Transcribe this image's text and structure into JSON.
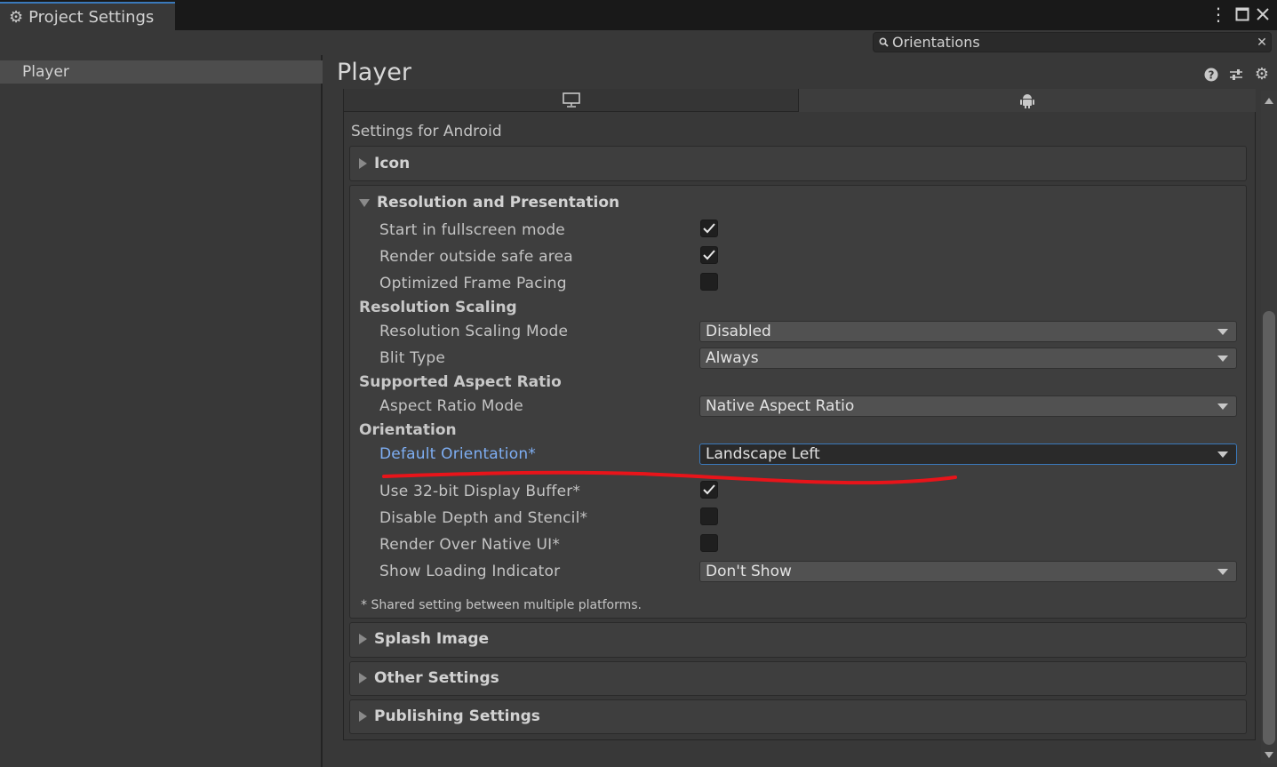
{
  "window": {
    "tab_title": "Project Settings",
    "search_value": "Orientations"
  },
  "sidebar": {
    "items": [
      {
        "label": "Player",
        "selected": true
      }
    ]
  },
  "header": {
    "title": "Player"
  },
  "platform_tabs": [
    {
      "icon": "monitor-icon",
      "selected": false
    },
    {
      "icon": "android-icon",
      "selected": true
    }
  ],
  "settings_for": "Settings for Android",
  "sections": {
    "icon": {
      "title": "Icon",
      "expanded": false
    },
    "resolution": {
      "title": "Resolution and Presentation",
      "expanded": true
    },
    "splash": {
      "title": "Splash Image",
      "expanded": false
    },
    "other": {
      "title": "Other Settings",
      "expanded": false
    },
    "publishing": {
      "title": "Publishing Settings",
      "expanded": false
    }
  },
  "resolution": {
    "start_fullscreen": {
      "label": "Start in fullscreen mode",
      "checked": true
    },
    "render_outside_safe": {
      "label": "Render outside safe area",
      "checked": true
    },
    "optimized_frame_pacing": {
      "label": "Optimized Frame Pacing",
      "checked": false
    },
    "group_resolution_scaling": "Resolution Scaling",
    "scaling_mode": {
      "label": "Resolution Scaling Mode",
      "value": "Disabled"
    },
    "blit_type": {
      "label": "Blit Type",
      "value": "Always"
    },
    "group_aspect": "Supported Aspect Ratio",
    "aspect_mode": {
      "label": "Aspect Ratio Mode",
      "value": "Native Aspect Ratio"
    },
    "group_orientation": "Orientation",
    "default_orientation": {
      "label": "Default Orientation*",
      "value": "Landscape Left"
    },
    "display_buffer": {
      "label": "Use 32-bit Display Buffer*",
      "checked": true
    },
    "disable_depth": {
      "label": "Disable Depth and Stencil*",
      "checked": false
    },
    "render_over_native": {
      "label": "Render Over Native UI*",
      "checked": false
    },
    "loading_indicator": {
      "label": "Show Loading Indicator",
      "value": "Don't Show"
    },
    "note": "* Shared setting between multiple platforms."
  },
  "colors": {
    "accent": "#3a79bb",
    "highlight_label": "#7eaef3",
    "annotation": "#e8141a"
  }
}
